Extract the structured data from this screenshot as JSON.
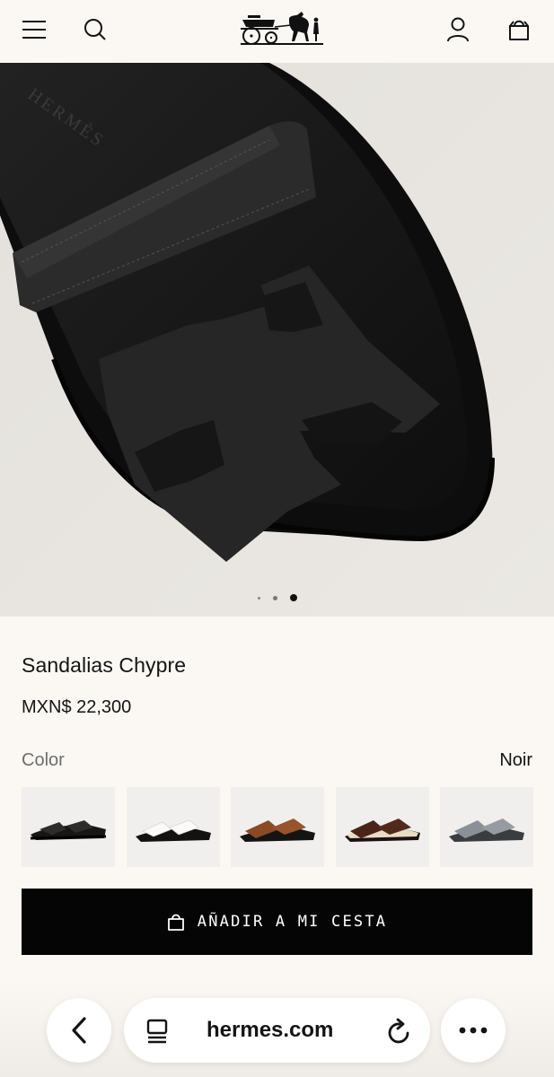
{
  "header": {
    "menu_icon": "hamburger-menu-icon",
    "search_icon": "search-icon",
    "logo": "hermes-carriage-logo",
    "account_icon": "user-icon",
    "cart_icon": "shopping-bag-icon"
  },
  "hero": {
    "image": "black-chypre-sandal-photo",
    "embossed_text": "HERMÈS",
    "carousel": {
      "total": 3,
      "current": 3
    }
  },
  "product": {
    "name": "Sandalias Chypre",
    "price": "MXN$ 22,300",
    "color_label": "Color",
    "color_value": "Noir"
  },
  "swatches": [
    {
      "name": "black",
      "color": "#1a1a1a"
    },
    {
      "name": "white",
      "color": "#f5f5f3"
    },
    {
      "name": "brown",
      "color": "#8a4a26"
    },
    {
      "name": "dark-brown-shearling",
      "color": "#4a2418"
    },
    {
      "name": "grey",
      "color": "#8a9096"
    }
  ],
  "cta": {
    "label": "AÑADIR A MI CESTA",
    "icon": "shopping-bag-icon"
  },
  "browser": {
    "back_icon": "chevron-left-icon",
    "tabs_icon": "tabs-icon",
    "url": "hermes.com",
    "reload_icon": "reload-icon",
    "more_icon": "more-dots-icon"
  },
  "colors": {
    "background": "#fbf8f4",
    "button": "#050505",
    "hero_bg": "#e9e6e1"
  }
}
